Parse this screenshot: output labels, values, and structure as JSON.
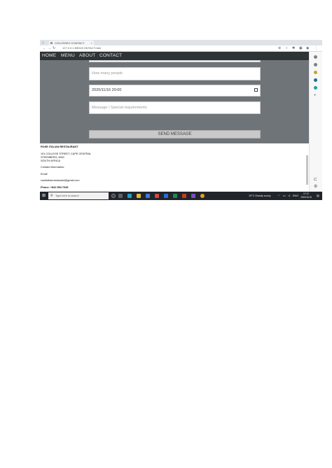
{
  "browser": {
    "tab_title": "COLOSSEO CONTACT",
    "tab_close": "×",
    "home_glyph": "⌂",
    "url": "127.0.0.1:5500/CONTACT.html",
    "back": "←",
    "forward": "→",
    "reload": "↻",
    "menu_dots": "⋮"
  },
  "nav": {
    "items": [
      "HOME",
      "MENU",
      "ABOUT",
      "CONTACT"
    ]
  },
  "form": {
    "people_placeholder": "How many people",
    "datetime_value": "2020/11/16  20:00",
    "message_placeholder": "Message \\ Special requirements",
    "send_label": "SEND MESSAGE"
  },
  "footer": {
    "name": "ROSE ITALIAN RESTAURANT",
    "address1": "101 COLLEGE STREET, CAPE CENTRAL",
    "address2": "STEENBERG, 8001",
    "country": "SOUTH AFRICA",
    "contact_heading": "Contact information:",
    "email_label": "Email",
    "email": "roseitalianrestaurant@gmail.com",
    "phone": "Phone: +842 554 7649"
  },
  "taskbar": {
    "search_placeholder": "Type here to search",
    "weather": "19°C Mostly sunny",
    "lang": "ENG",
    "time": "17:12",
    "date": "2020/11/16"
  },
  "colors": {
    "page_bg": "#6e7478",
    "navbar_bg": "#2e3336",
    "button_bg": "#c9c9c9",
    "taskbar_bg": "#21252b",
    "side_icons": [
      "#808080",
      "#808080",
      "#c8a42b",
      "#1d6f8a",
      "#1aa39b"
    ]
  }
}
